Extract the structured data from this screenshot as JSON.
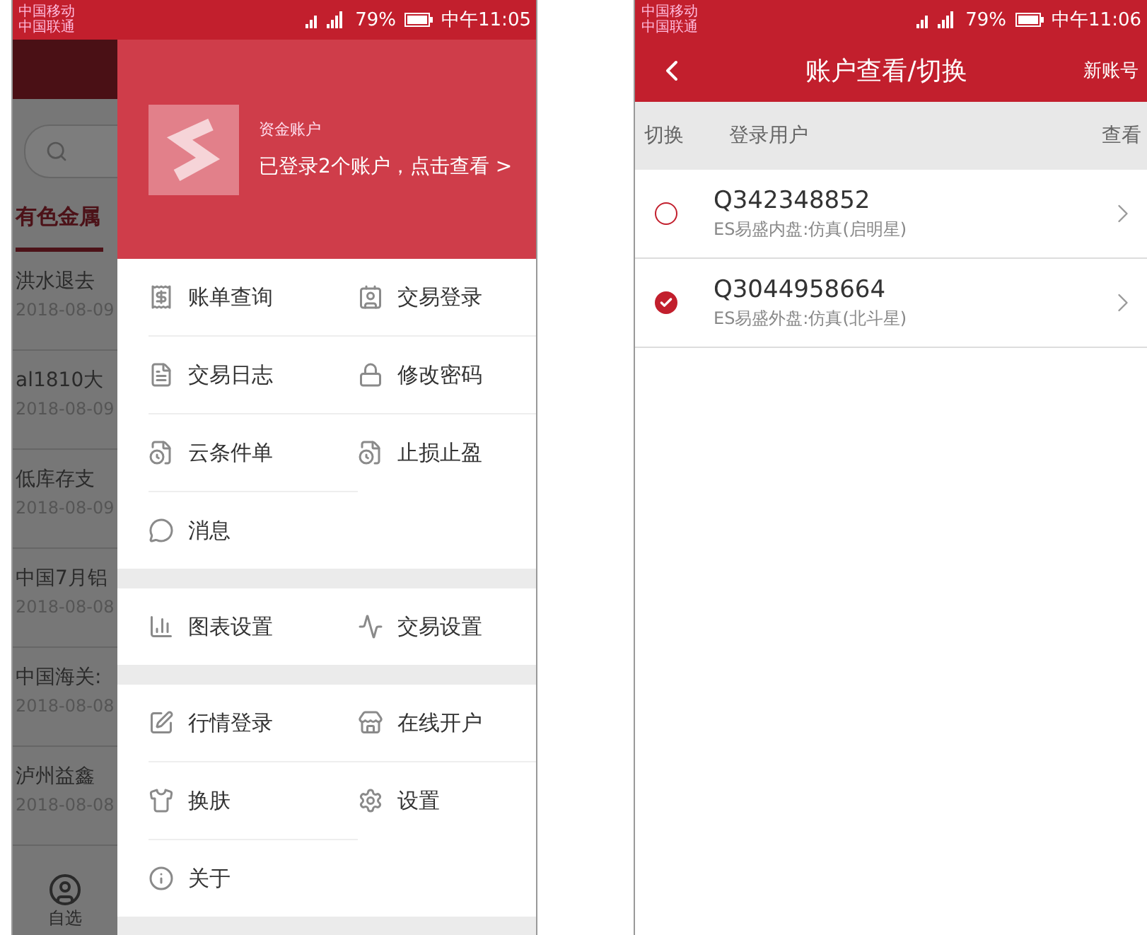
{
  "left_phone": {
    "status_bar": {
      "carriers": [
        "中国移动",
        "中国联通"
      ],
      "battery": "79%",
      "time": "中午11:05"
    },
    "background_app": {
      "tabs": [
        {
          "label": "有色金属",
          "selected": true
        }
      ],
      "news": [
        {
          "title": "洪水退去",
          "date": "2018-08-09"
        },
        {
          "title": "al1810大",
          "date": "2018-08-09"
        },
        {
          "title": "低库存支",
          "date": "2018-08-09"
        },
        {
          "title": "中国7月铝",
          "date": "2018-08-08"
        },
        {
          "title": "中国海关:",
          "date": "2018-08-08"
        },
        {
          "title": "泸州益鑫",
          "date": "2018-08-08"
        }
      ],
      "bottom_nav": [
        {
          "label": "自选",
          "selected": false
        }
      ]
    },
    "drawer": {
      "account": {
        "title": "资金账户",
        "subtitle": "已登录2个账户，点击查看 >"
      },
      "sections": [
        {
          "items": [
            {
              "label": "账单查询"
            },
            {
              "label": "交易登录"
            },
            {
              "label": "交易日志"
            },
            {
              "label": "修改密码"
            },
            {
              "label": "云条件单"
            },
            {
              "label": "止损止盈"
            },
            {
              "label": "消息"
            }
          ]
        },
        {
          "items": [
            {
              "label": "图表设置"
            },
            {
              "label": "交易设置"
            }
          ]
        },
        {
          "items": [
            {
              "label": "行情登录"
            },
            {
              "label": "在线开户"
            },
            {
              "label": "换肤"
            },
            {
              "label": "设置"
            },
            {
              "label": "关于"
            }
          ]
        }
      ]
    }
  },
  "right_phone": {
    "status_bar": {
      "carriers": [
        "中国移动",
        "中国联通"
      ],
      "battery": "79%",
      "time": "中午11:06"
    },
    "title": "账户查看/切换",
    "action": "新账号",
    "columns": [
      "切换",
      "登录用户",
      "查看"
    ],
    "accounts": [
      {
        "id": "Q342348852",
        "server": "ES易盛内盘:仿真(启明星)",
        "selected": false
      },
      {
        "id": "Q3044958664",
        "server": "ES易盛外盘:仿真(北斗星)",
        "selected": true
      }
    ]
  }
}
